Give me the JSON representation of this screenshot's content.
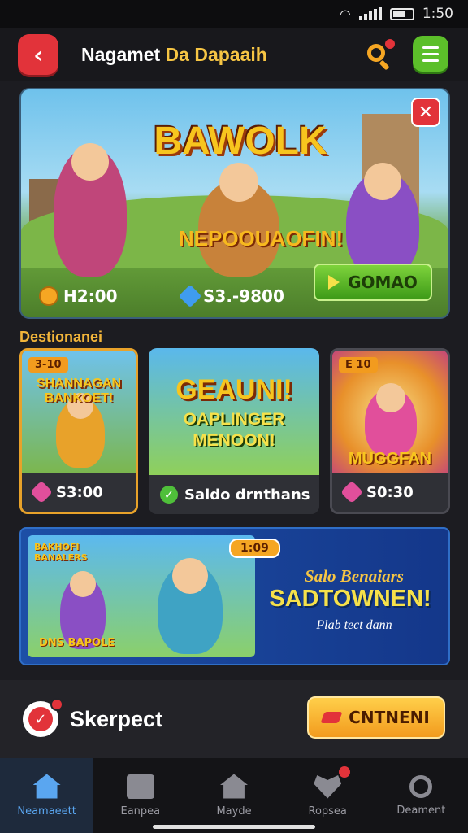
{
  "status_bar": {
    "time": "1:50"
  },
  "header": {
    "title_part1": "Nagamet",
    "title_part2": "Da Dapaaih"
  },
  "hero": {
    "title": "BAWOLK",
    "subtitle": "NEPOOUAOFIN!",
    "stat_coins": "H2:00",
    "stat_gems": "S3.-9800",
    "play_label": "GOMAO"
  },
  "section": {
    "title": "Destionanei"
  },
  "cards": [
    {
      "tag": "3-10",
      "art_title": "SHANNAGAN BANKOET!",
      "price": "S3:00"
    },
    {
      "tag": "",
      "art_title": "GEAUNI!",
      "art_sub1": "OAPLINGER",
      "art_sub2": "MENOON!",
      "price": "Saldo drnthans"
    },
    {
      "tag": "E 10",
      "art_title": "MUGGFAN",
      "price": "S0:30"
    }
  ],
  "banner": {
    "badge": "1:09",
    "art_label_top": "BAKHOFI BANALERS",
    "art_label_bottom": "DNS BAPOLE",
    "line1": "Salo Benaiars",
    "line2": "SADTOWNEN!",
    "line3": "Plab tect dann"
  },
  "action_bar": {
    "profile_label": "Skerpect",
    "cta_label": "CNTNENI"
  },
  "nav": [
    {
      "label": "Neamaeett"
    },
    {
      "label": "Eanpea"
    },
    {
      "label": "Mayde"
    },
    {
      "label": "Ropsea"
    },
    {
      "label": "Deament"
    }
  ],
  "colors": {
    "accent_red": "#e2333a",
    "accent_gold": "#f6c544",
    "accent_green": "#5cbf2a",
    "active_nav": "#5aa6f0"
  }
}
